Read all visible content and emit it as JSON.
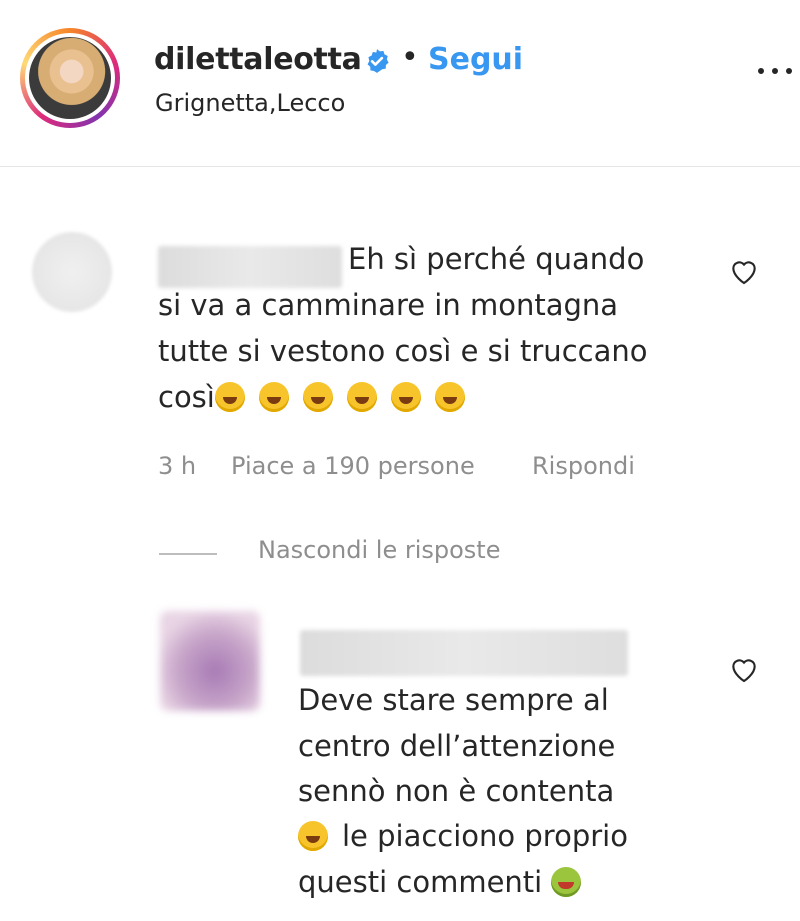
{
  "header": {
    "username": "dilettaleotta",
    "separator": "•",
    "follow_label": "Segui",
    "location": "Grignetta,Lecco",
    "verified_icon": "verified-badge-icon",
    "more_icon": "more-options-icon"
  },
  "comments": [
    {
      "text_lines": [
        "Eh sì perché quando",
        "si va a camminare in montagna",
        "tutte si vestono così e si truccano",
        "così"
      ],
      "emoji": "face-with-tears-of-joy ×6",
      "time": "3 h",
      "likes": "Piace a 190 persone",
      "reply_label": "Rispondi"
    },
    {
      "text_lines": [
        "Deve stare sempre al",
        "centro dell’attenzione",
        "sennò non è contenta",
        "le piacciono proprio",
        "questi commenti"
      ],
      "emoji": [
        "face-with-tears-of-joy",
        "nauseated-face"
      ]
    }
  ],
  "replies_toggle": "Nascondi le risposte",
  "colors": {
    "accent": "#3897f0",
    "text": "#262626",
    "muted": "#8e8e8e"
  }
}
